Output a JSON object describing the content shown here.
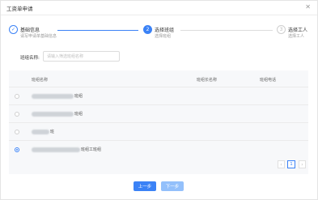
{
  "dialog": {
    "title": "工资单申请",
    "close_icon": "close-icon"
  },
  "steps": [
    {
      "index": "✓",
      "title": "基础信息",
      "desc": "请写申请单基础信息",
      "state": "done"
    },
    {
      "index": "2",
      "title": "选择班组",
      "desc": "选择班组",
      "state": "active"
    },
    {
      "index": "3",
      "title": "选择工人",
      "desc": "选择工人",
      "state": "pending"
    }
  ],
  "search": {
    "label": "班组名称:",
    "placeholder": "请输入筛选班组名称"
  },
  "table": {
    "columns": [
      "班组名称",
      "班组长名称",
      "班组电话"
    ],
    "rows": [
      {
        "name_suffix": "班组",
        "selected": false
      },
      {
        "name_suffix": "班组",
        "selected": false
      },
      {
        "name_suffix": "班",
        "selected": false
      },
      {
        "name_suffix": "班组工班组",
        "selected": true
      }
    ]
  },
  "pagination": {
    "prev": "‹",
    "current": "1",
    "next": "›"
  },
  "footer": {
    "prev_label": "上一步",
    "next_label": "下一步"
  },
  "colors": {
    "primary": "#3b82f6",
    "primary_disabled": "#93c0fb"
  }
}
